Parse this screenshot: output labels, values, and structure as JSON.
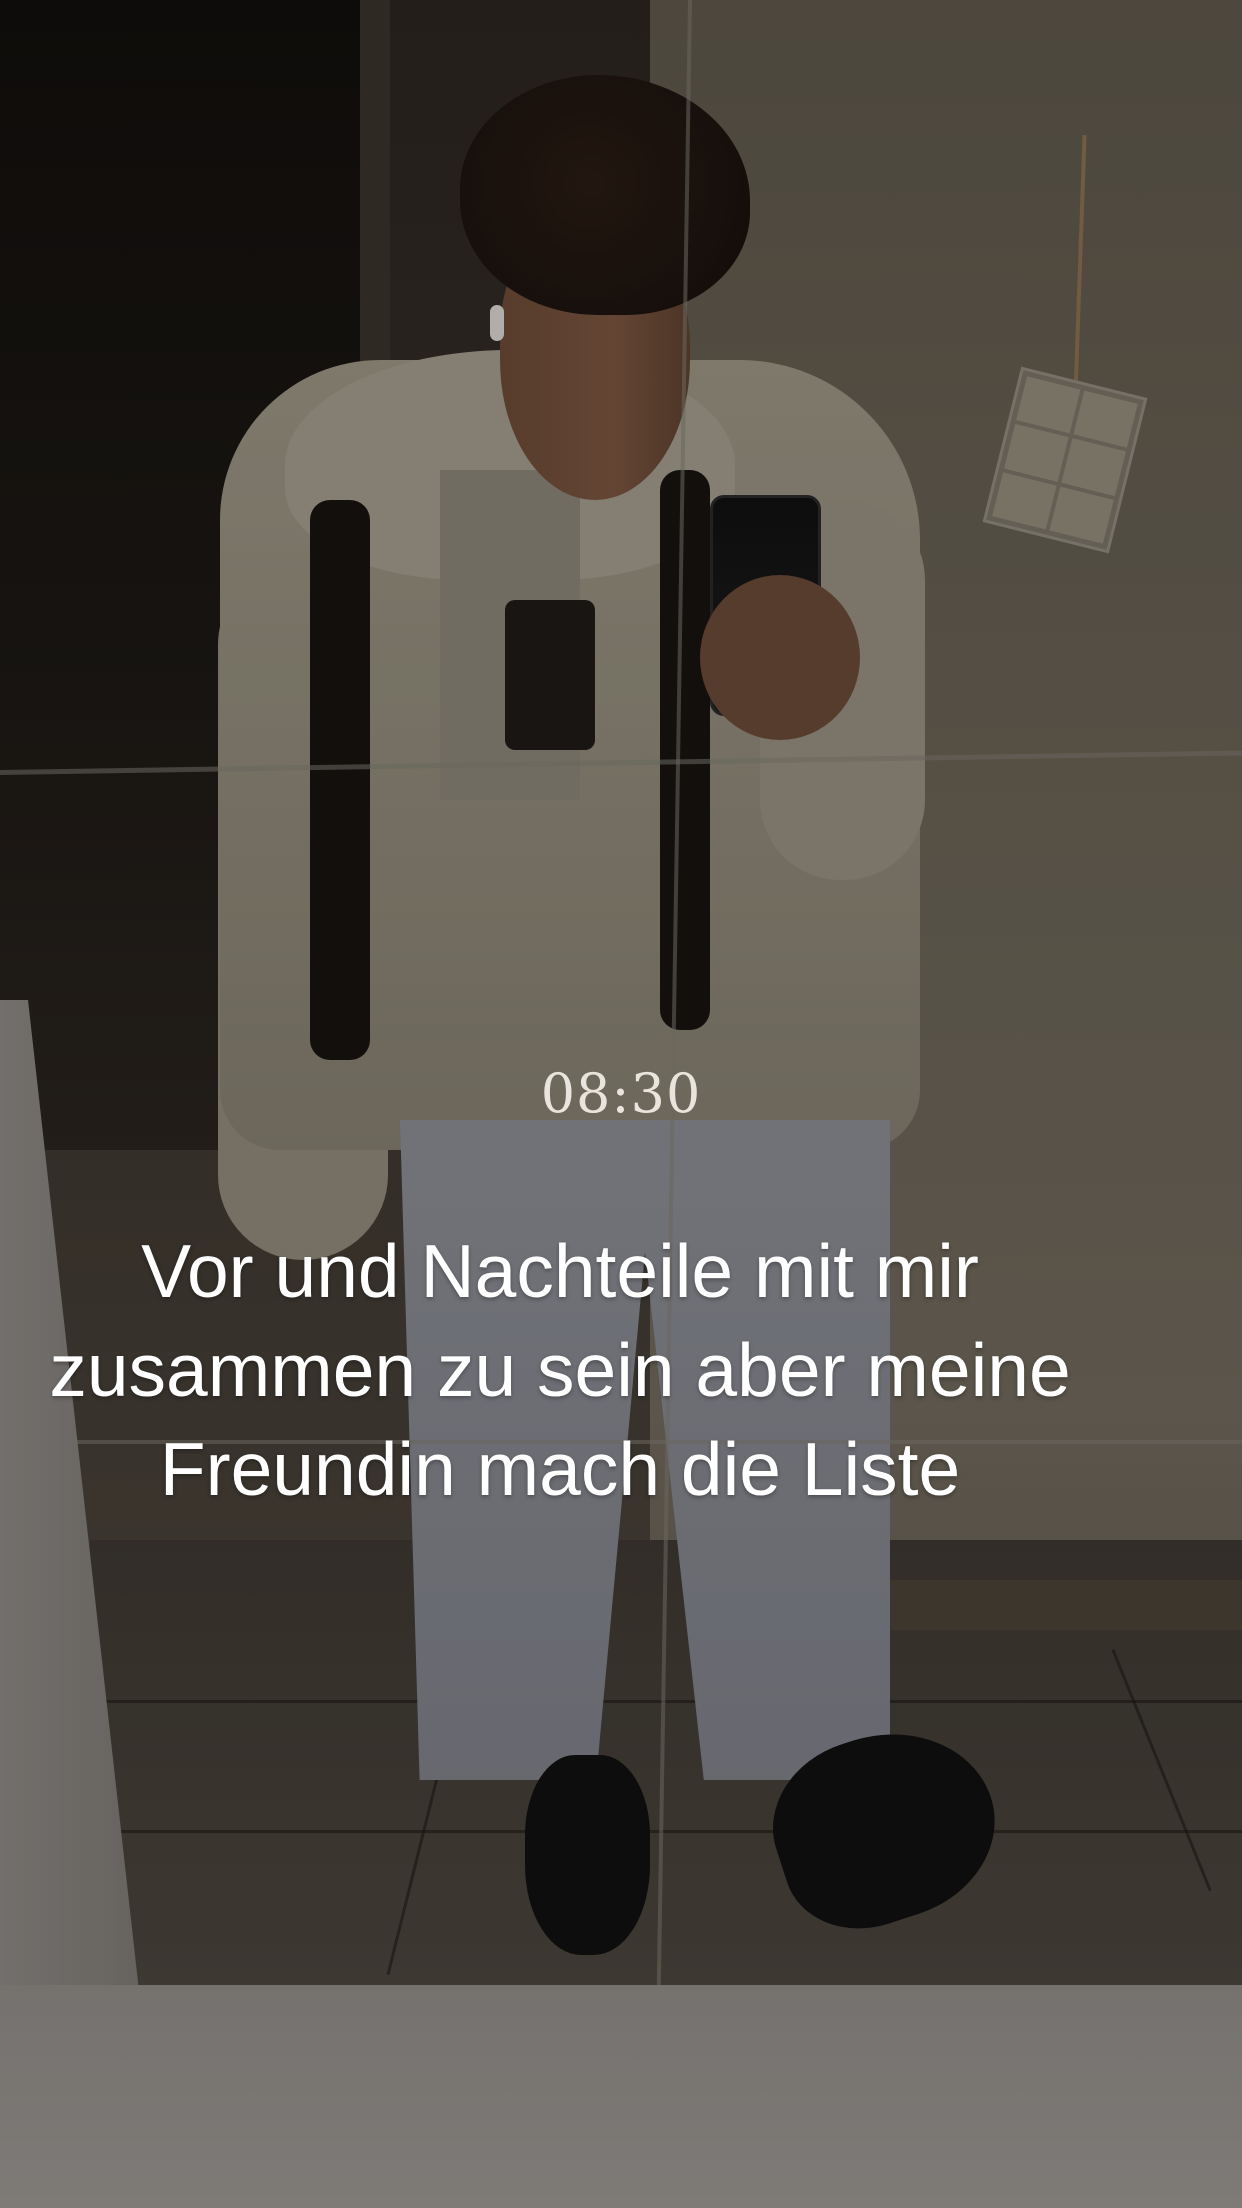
{
  "overlay": {
    "time": "08:30",
    "caption": "Vor und Nachteile mit mir zusammen zu sein aber meine Freundin mach die Liste"
  },
  "colors": {
    "caption_text": "#ffffff",
    "time_text": "#e9e5dd"
  }
}
